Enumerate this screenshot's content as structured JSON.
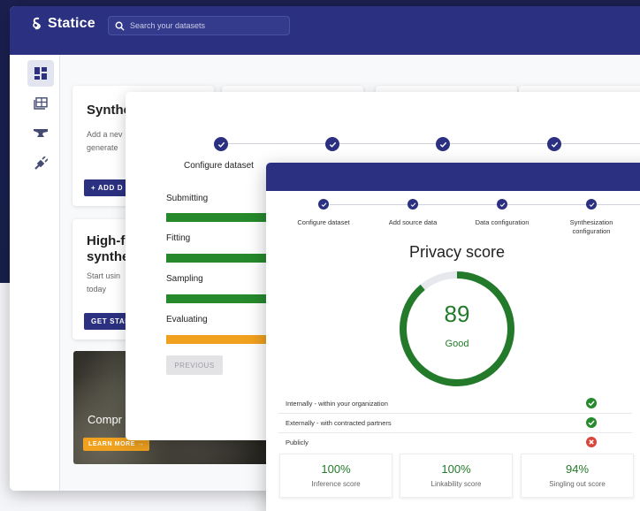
{
  "app": {
    "brand": "Statice",
    "search_placeholder": "Search your datasets"
  },
  "sidebar": {
    "items": [
      {
        "icon": "dashboard-icon",
        "active": true
      },
      {
        "icon": "datasets-icon",
        "active": false
      },
      {
        "icon": "anvil-icon",
        "active": false
      },
      {
        "icon": "plug-icon",
        "active": false
      }
    ]
  },
  "cards": {
    "synth": {
      "title": "Synthe",
      "desc_line1": "Add a nev",
      "desc_line2": "generate",
      "button": "+  ADD D"
    },
    "highf": {
      "title_line1": "High-f",
      "title_line2": "synthe",
      "desc_line1": "Start usin",
      "desc_line2": "today",
      "button": "GET STAR"
    },
    "image": {
      "title": "Compr",
      "button": "LEARN MORE  →"
    }
  },
  "dialog_progress": {
    "step_label": "Configure dataset",
    "stages": [
      {
        "label": "Submitting",
        "status": "done",
        "color": "#268a2c"
      },
      {
        "label": "Fitting",
        "status": "done",
        "color": "#268a2c"
      },
      {
        "label": "Sampling",
        "status": "done",
        "color": "#268a2c"
      },
      {
        "label": "Evaluating",
        "status": "in-progress",
        "color": "#f0a11e"
      }
    ],
    "previous_button": "PREVIOUS"
  },
  "dialog_privacy": {
    "steps": [
      "Configure dataset",
      "Add source data",
      "Data configuration",
      "Synthesization configuration"
    ],
    "title": "Privacy score",
    "score": "89",
    "score_fraction": 0.89,
    "score_label": "Good",
    "accent": "#237a2a",
    "checks": [
      {
        "label": "Internally - within your organization",
        "ok": true
      },
      {
        "label": "Externally - with contracted partners",
        "ok": true
      },
      {
        "label": "Publicly",
        "ok": false
      }
    ],
    "scores": [
      {
        "value": "100%",
        "label": "Inference score"
      },
      {
        "value": "100%",
        "label": "Linkability score"
      },
      {
        "value": "94%",
        "label": "Singling out score"
      }
    ]
  },
  "colors": {
    "navy": "#2b3180",
    "success": "#268a2c",
    "warning": "#f0a11e",
    "error": "#d9453b"
  }
}
